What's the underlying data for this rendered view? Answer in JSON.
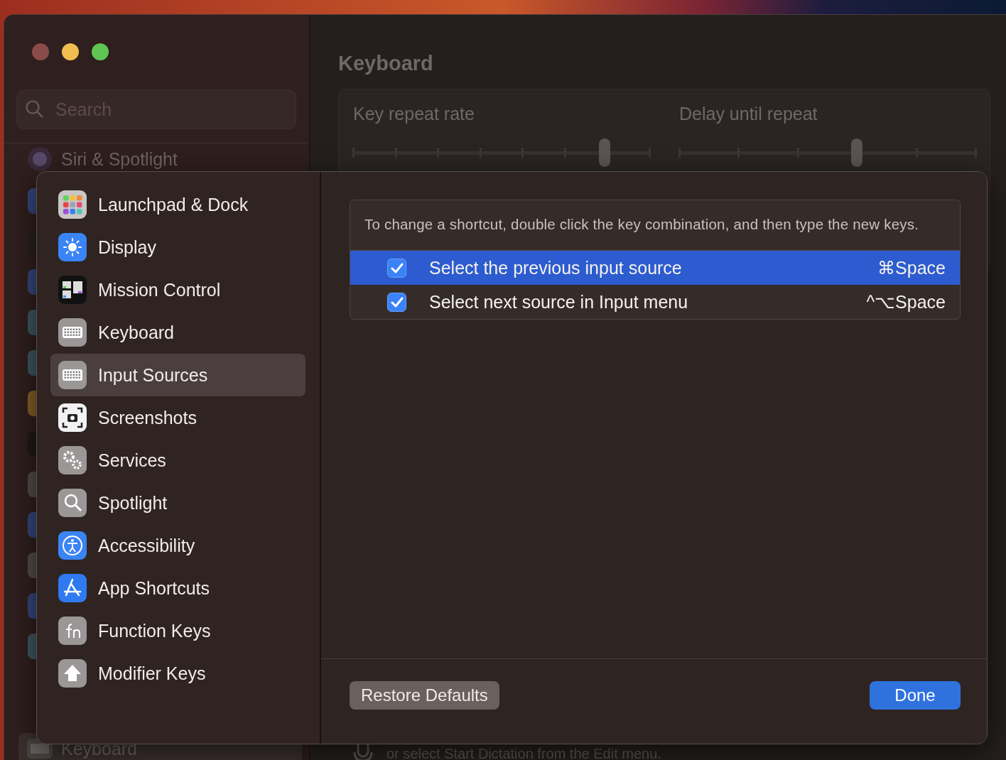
{
  "background_window": {
    "search": {
      "placeholder": "Search"
    },
    "sidebar_items": [
      {
        "label": "Siri & Spotlight",
        "selected": false
      },
      {
        "label": "Keyboard",
        "selected": true
      }
    ],
    "title": "Keyboard",
    "sliders": [
      {
        "label": "Key repeat rate",
        "level": 0.85
      },
      {
        "label": "Delay until repeat",
        "level": 0.6
      }
    ],
    "footer_text": "or select Start Dictation from the Edit menu."
  },
  "sheet": {
    "sidebar_items": [
      {
        "label": "Launchpad & Dock",
        "selected": false
      },
      {
        "label": "Display",
        "selected": false
      },
      {
        "label": "Mission Control",
        "selected": false
      },
      {
        "label": "Keyboard",
        "selected": false
      },
      {
        "label": "Input Sources",
        "selected": true
      },
      {
        "label": "Screenshots",
        "selected": false
      },
      {
        "label": "Services",
        "selected": false
      },
      {
        "label": "Spotlight",
        "selected": false
      },
      {
        "label": "Accessibility",
        "selected": false
      },
      {
        "label": "App Shortcuts",
        "selected": false
      },
      {
        "label": "Function Keys",
        "selected": false
      },
      {
        "label": "Modifier Keys",
        "selected": false
      }
    ],
    "instructions": "To change a shortcut, double click the key combination, and then type the new keys.",
    "shortcuts": [
      {
        "label": "Select the previous input source",
        "keys": "⌘Space",
        "checked": true,
        "selected": true
      },
      {
        "label": "Select next source in Input menu",
        "keys": "^⌥Space",
        "checked": true,
        "selected": false
      }
    ],
    "buttons": [
      {
        "label": "Restore Defaults",
        "kind": "secondary"
      },
      {
        "label": "Done",
        "kind": "primary"
      }
    ]
  }
}
